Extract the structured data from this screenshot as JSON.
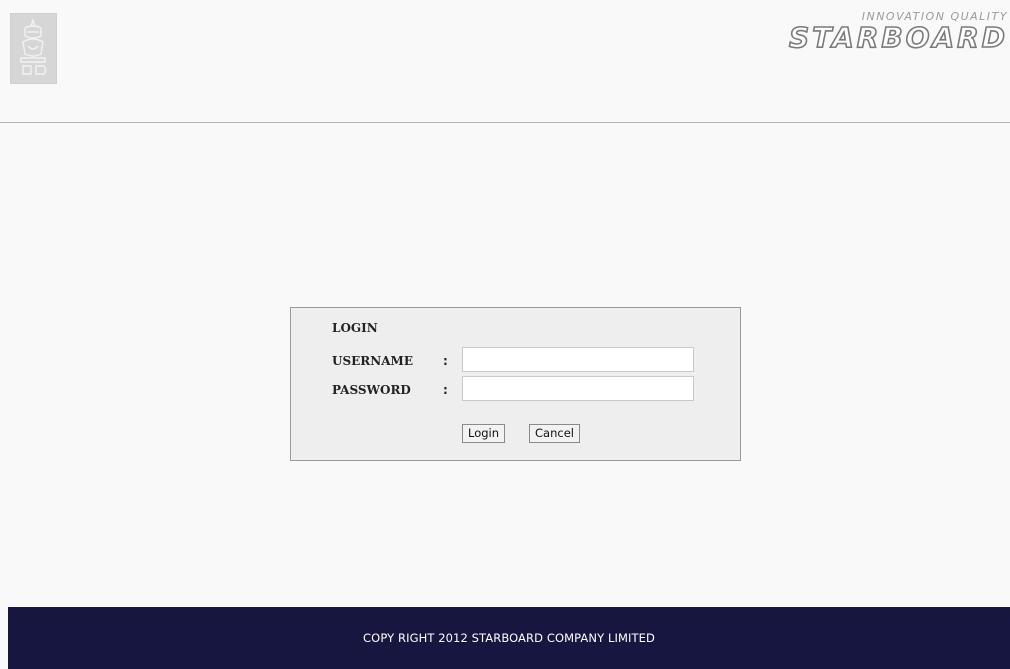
{
  "header": {
    "left_logo_icon": "emblem-icon",
    "brand": {
      "tagline": "INNOVATION QUALITY",
      "name": "STARBOARD"
    }
  },
  "login": {
    "title": "LOGIN",
    "username_label": "USERNAME",
    "password_label": "PASSWORD",
    "colon": ":",
    "username_value": "",
    "password_value": "",
    "login_button": "Login",
    "cancel_button": "Cancel"
  },
  "footer": {
    "text": "COPY RIGHT 2012 STARBOARD COMPANY LIMITED"
  },
  "colors": {
    "footer_bg": "#161640",
    "page_bg": "#f9f9f9",
    "box_bg": "#eeeeee"
  }
}
